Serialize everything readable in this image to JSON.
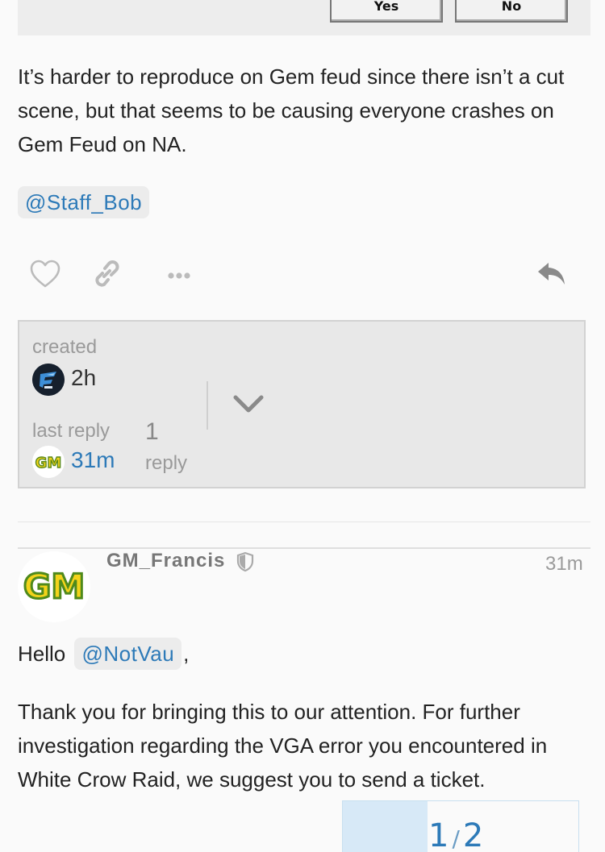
{
  "dialog": {
    "yes_label": "Yes",
    "no_label": "No"
  },
  "post1": {
    "text": "It’s harder to reproduce on Gem feud since there isn’t a cut scene, but that seems to be causing everyone crashes on Gem Feud on NA.",
    "mention": "@Staff_Bob"
  },
  "actions": {
    "like_icon": "heart-icon",
    "link_icon": "link-icon",
    "more_icon": "ellipsis-icon",
    "reply_icon": "reply-icon"
  },
  "topic_map": {
    "created_label": "created",
    "created_time": "2h",
    "last_reply_label": "last reply",
    "last_reply_time": "31m",
    "reply_count": "1",
    "reply_label": "reply",
    "created_avatar_icon": "esl-avatar",
    "last_avatar_text": "GM"
  },
  "post2": {
    "avatar_text": "GM",
    "username": "GM_Francis",
    "time": "31m",
    "greeting": "Hello",
    "mention": "@NotVau",
    "greeting_suffix": ",",
    "text": "Thank you for bringing this to our attention. For further investigation regarding the VGA error you encountered in White Crow Raid, we suggest you to send a ticket."
  },
  "timeline": {
    "current": "1",
    "separator": "/",
    "total": "2",
    "progress": 0.36
  },
  "colors": {
    "link": "#2d7ab8",
    "progress_fill": "#d7e9f7"
  }
}
